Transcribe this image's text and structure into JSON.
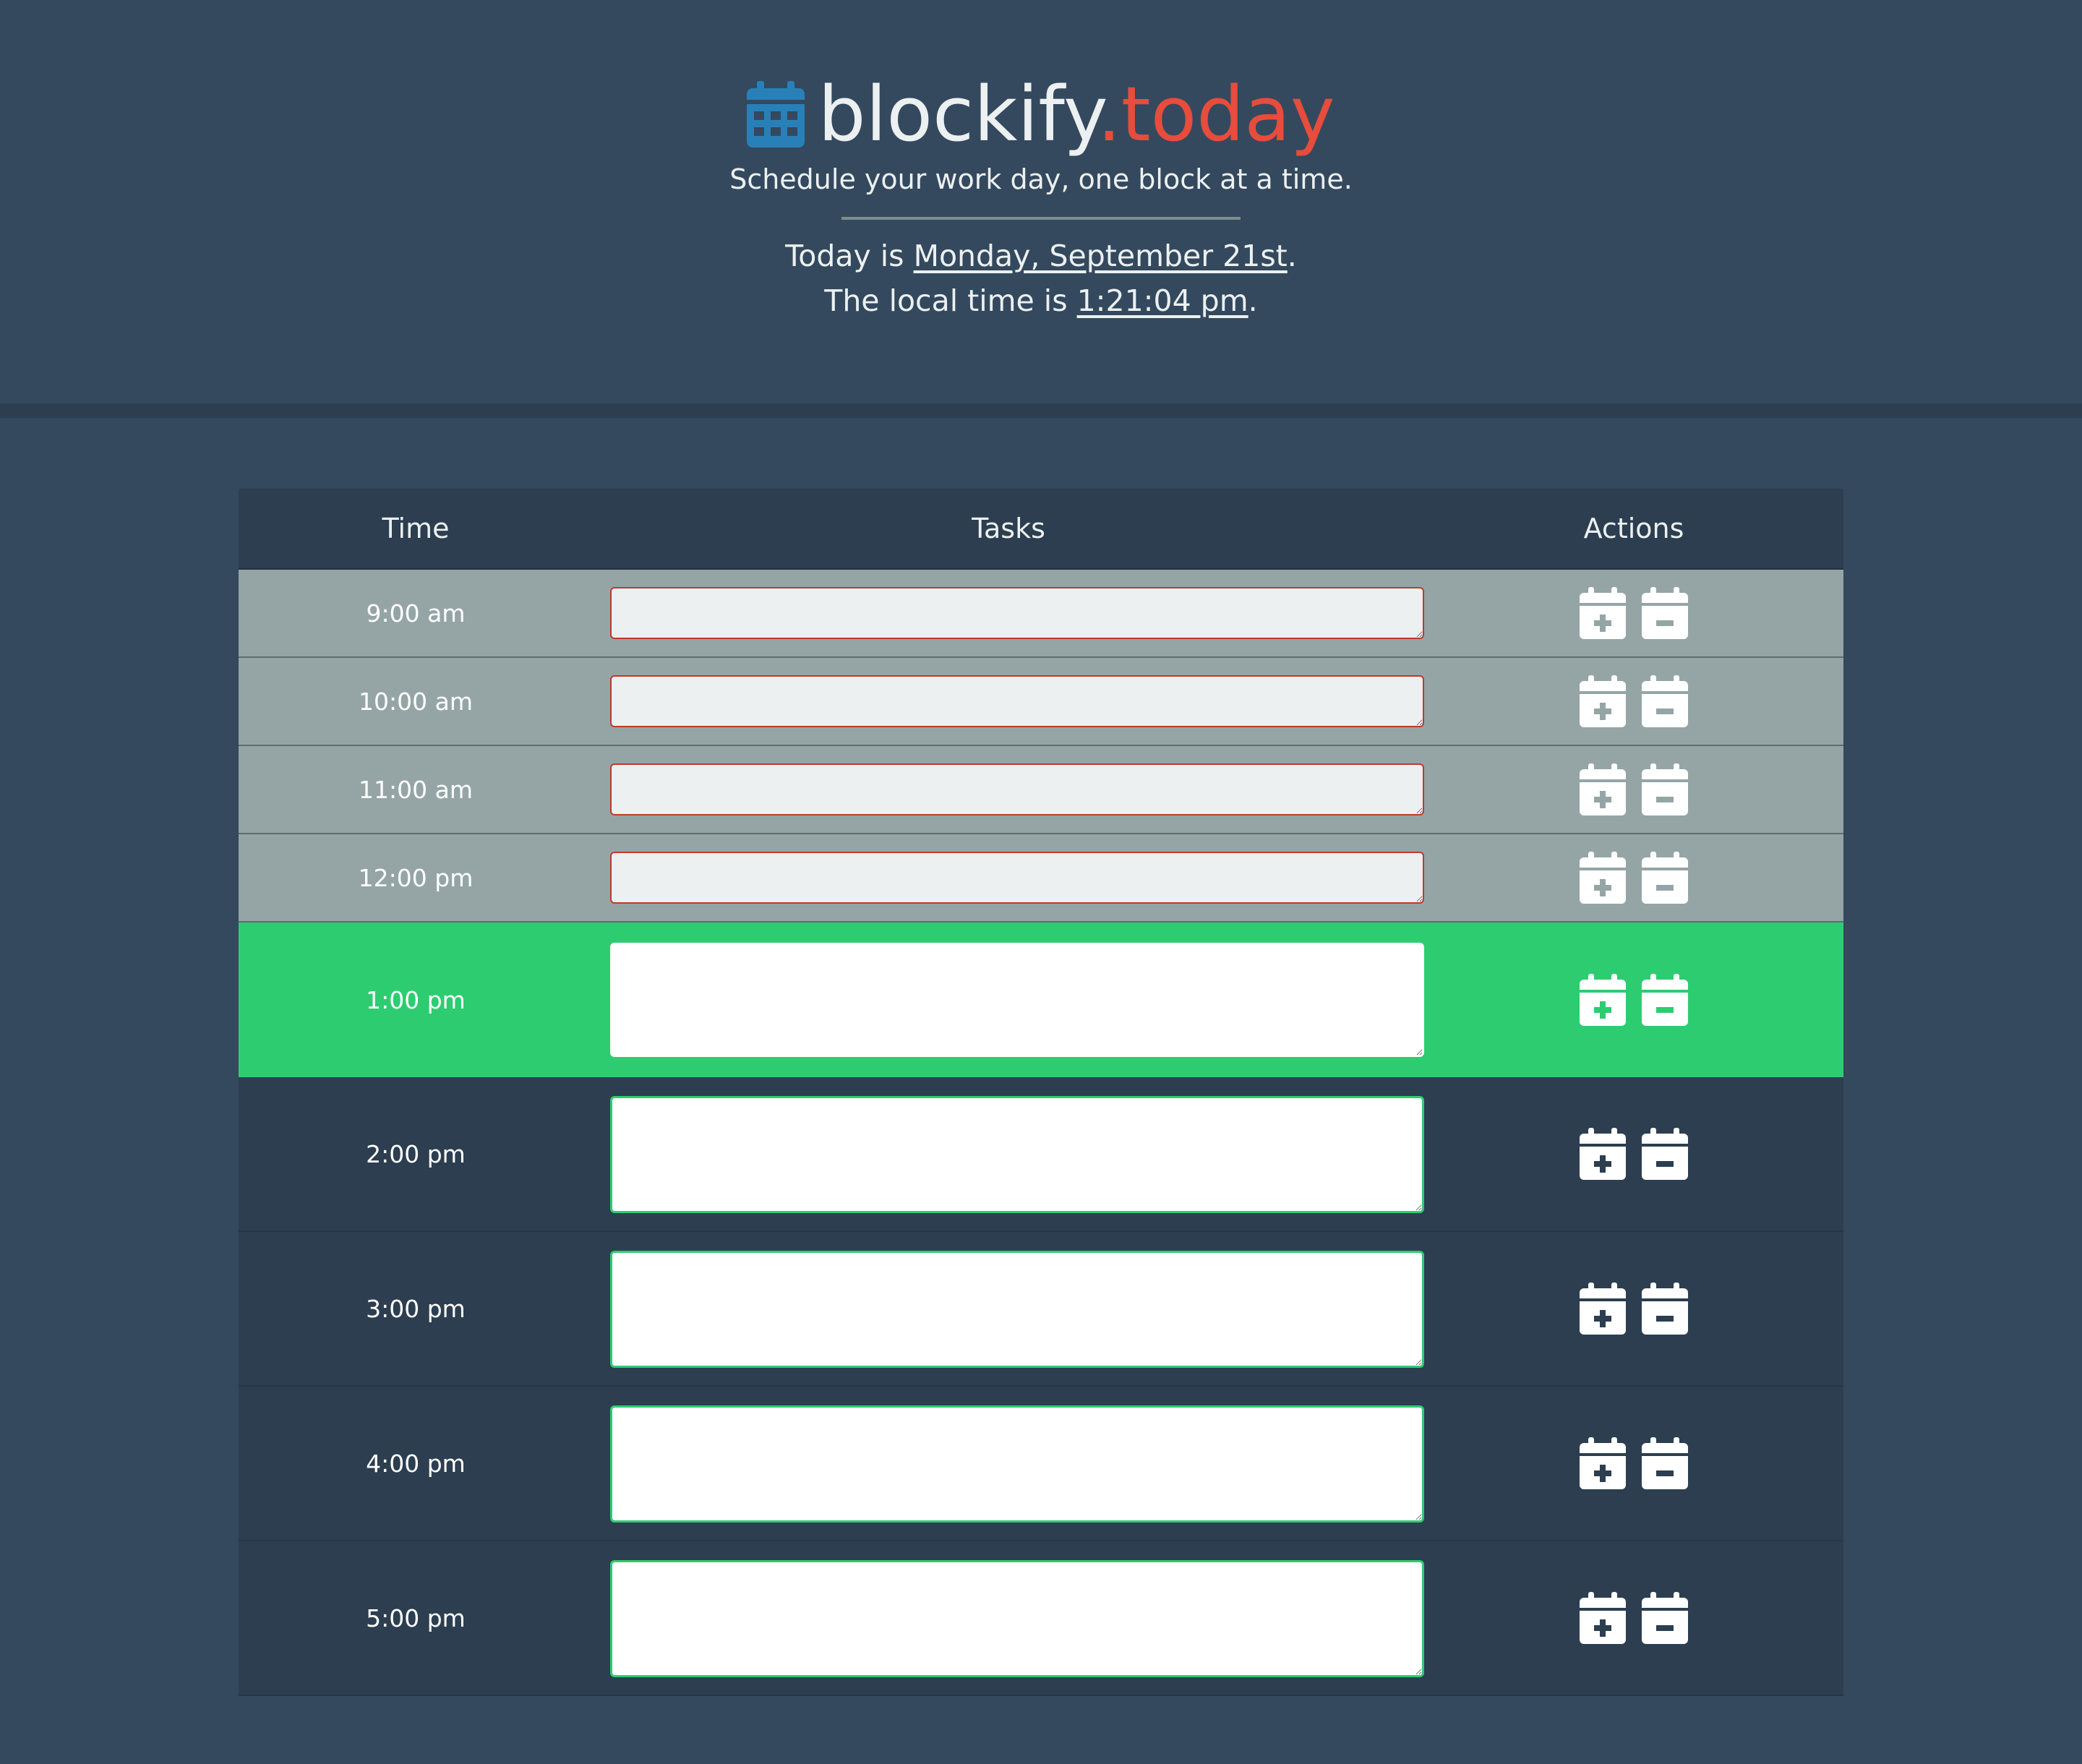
{
  "header": {
    "brand_name": "blockify",
    "brand_tld": ".today",
    "tagline": "Schedule your work day, one block at a time.",
    "today_prefix": "Today is ",
    "today_date": "Monday, September 21st",
    "today_suffix": ".",
    "time_prefix": "The local time is ",
    "time_value": "1:21:04 pm",
    "time_suffix": "."
  },
  "colors": {
    "background": "#34495e",
    "dark": "#2c3e50",
    "past": "#95a5a6",
    "present": "#2ecc71",
    "accent_red": "#e74c3c",
    "logo_blue": "#2980b9"
  },
  "table": {
    "headers": {
      "time": "Time",
      "tasks": "Tasks",
      "actions": "Actions"
    },
    "rows": [
      {
        "time": "9:00 am",
        "state": "past",
        "task": ""
      },
      {
        "time": "10:00 am",
        "state": "past",
        "task": ""
      },
      {
        "time": "11:00 am",
        "state": "past",
        "task": ""
      },
      {
        "time": "12:00 pm",
        "state": "past",
        "task": ""
      },
      {
        "time": "1:00 pm",
        "state": "present",
        "task": ""
      },
      {
        "time": "2:00 pm",
        "state": "future",
        "task": ""
      },
      {
        "time": "3:00 pm",
        "state": "future",
        "task": ""
      },
      {
        "time": "4:00 pm",
        "state": "future",
        "task": ""
      },
      {
        "time": "5:00 pm",
        "state": "future",
        "task": ""
      }
    ],
    "actions": {
      "save_icon": "calendar-plus-icon",
      "clear_icon": "calendar-minus-icon"
    }
  }
}
